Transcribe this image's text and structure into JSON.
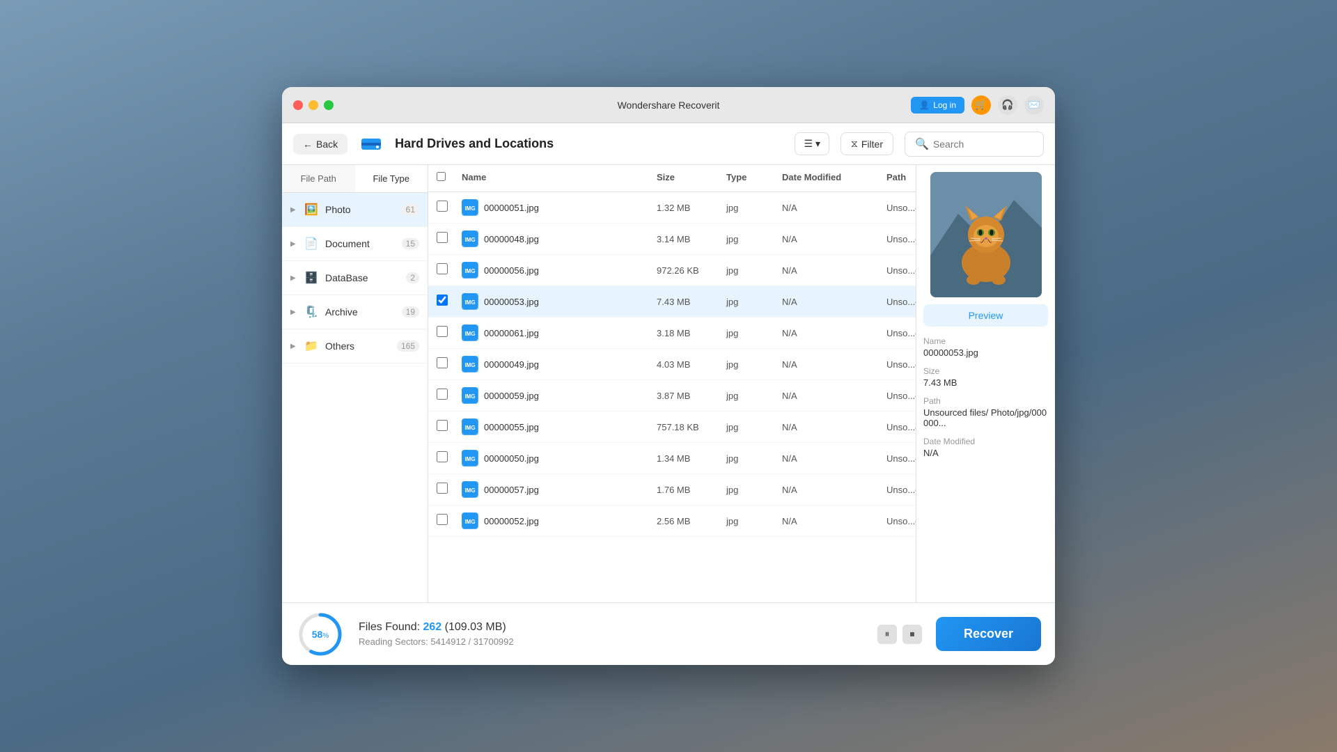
{
  "app": {
    "title": "Wondershare Recoverit"
  },
  "titlebar": {
    "title": "Wondershare Recoverit",
    "login_label": "Log in",
    "icons": [
      "cart-icon",
      "headphone-icon",
      "mail-icon"
    ]
  },
  "header": {
    "back_label": "Back",
    "location_title": "Hard Drives and Locations",
    "sort_label": "≡",
    "filter_label": "Filter",
    "search_placeholder": "Search"
  },
  "tabs": {
    "file_path_label": "File Path",
    "file_type_label": "File Type"
  },
  "sidebar": {
    "items": [
      {
        "label": "Photo",
        "count": "61",
        "icon": "🖼️"
      },
      {
        "label": "Document",
        "count": "15",
        "icon": "📄"
      },
      {
        "label": "DataBase",
        "count": "2",
        "icon": "🗄️"
      },
      {
        "label": "Archive",
        "count": "19",
        "icon": "🗜️"
      },
      {
        "label": "Others",
        "count": "165",
        "icon": "📁"
      }
    ]
  },
  "file_list": {
    "headers": {
      "name": "Name",
      "size": "Size",
      "type": "Type",
      "date_modified": "Date Modified",
      "path": "Path"
    },
    "files": [
      {
        "name": "00000051.jpg",
        "size": "1.32 MB",
        "type": "jpg",
        "date": "N/A",
        "path": "Unso...oto/jpg",
        "selected": false
      },
      {
        "name": "00000048.jpg",
        "size": "3.14 MB",
        "type": "jpg",
        "date": "N/A",
        "path": "Unso...oto/jpg",
        "selected": false
      },
      {
        "name": "00000056.jpg",
        "size": "972.26 KB",
        "type": "jpg",
        "date": "N/A",
        "path": "Unso...oto/jpg",
        "selected": false
      },
      {
        "name": "00000053.jpg",
        "size": "7.43 MB",
        "type": "jpg",
        "date": "N/A",
        "path": "Unso...oto/jpg",
        "selected": true
      },
      {
        "name": "00000061.jpg",
        "size": "3.18 MB",
        "type": "jpg",
        "date": "N/A",
        "path": "Unso...oto/jpg",
        "selected": false
      },
      {
        "name": "00000049.jpg",
        "size": "4.03 MB",
        "type": "jpg",
        "date": "N/A",
        "path": "Unso...oto/jpg",
        "selected": false
      },
      {
        "name": "00000059.jpg",
        "size": "3.87 MB",
        "type": "jpg",
        "date": "N/A",
        "path": "Unso...oto/jpg",
        "selected": false
      },
      {
        "name": "00000055.jpg",
        "size": "757.18 KB",
        "type": "jpg",
        "date": "N/A",
        "path": "Unso...oto/jpg",
        "selected": false
      },
      {
        "name": "00000050.jpg",
        "size": "1.34 MB",
        "type": "jpg",
        "date": "N/A",
        "path": "Unso...oto/jpg",
        "selected": false
      },
      {
        "name": "00000057.jpg",
        "size": "1.76 MB",
        "type": "jpg",
        "date": "N/A",
        "path": "Unso...oto/jpg",
        "selected": false
      },
      {
        "name": "00000052.jpg",
        "size": "2.56 MB",
        "type": "jpg",
        "date": "N/A",
        "path": "Unso...oto/jpg",
        "selected": false
      }
    ]
  },
  "preview": {
    "button_label": "Preview",
    "name_label": "Name",
    "name_value": "00000053.jpg",
    "size_label": "Size",
    "size_value": "7.43 MB",
    "path_label": "Path",
    "path_value": "Unsourced files/ Photo/jpg/000000...",
    "date_label": "Date Modified",
    "date_value": "N/A"
  },
  "bottom_bar": {
    "progress_percent": "58%",
    "files_found_label": "Files Found:",
    "files_count": "262",
    "files_size": "(109.03 MB)",
    "reading_label": "Reading Sectors: 5414912 / 31700992",
    "recover_label": "Recover"
  }
}
